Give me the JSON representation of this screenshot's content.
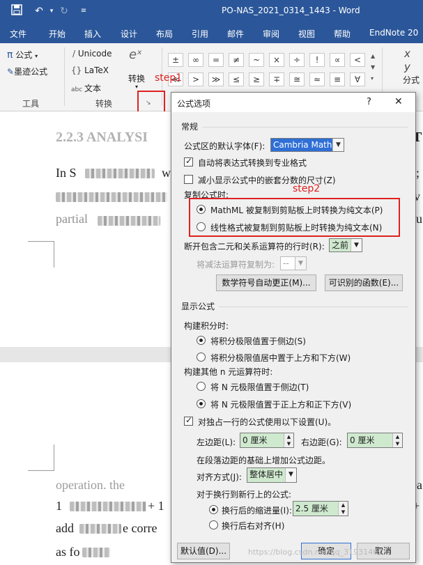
{
  "titlebar": {
    "title": "PO-NAS_2021_0314_1443  -  Word"
  },
  "menu": [
    "文件",
    "开始",
    "插入",
    "设计",
    "布局",
    "引用",
    "邮件",
    "审阅",
    "视图",
    "帮助",
    "EndNote 20"
  ],
  "ribbon": {
    "formula": "公式",
    "ink_formula": "墨迹公式",
    "group_tools": "工具",
    "unicode": "Unicode",
    "latex": "LaTeX",
    "text": "文本",
    "convert": "转换",
    "group_convert": "转换",
    "fraction": "分式",
    "symbols_row1": [
      "±",
      "∞",
      "=",
      "≠",
      "~",
      "×",
      "÷",
      "!",
      "∝",
      "<"
    ],
    "symbols_row2": [
      "≪",
      ">",
      "≫",
      "≤",
      "≥",
      "∓",
      "≅",
      "≈",
      "≡",
      "∀"
    ]
  },
  "annotations": {
    "step1": "step1",
    "step2": "step2"
  },
  "dialog": {
    "title": "公式选项",
    "help": "?",
    "close": "✕",
    "section_general": "常规",
    "default_font_label": "公式区的默认字体(F):",
    "default_font_value": "Cambria Math",
    "auto_convert_label": "自动将表达式转换到专业格式",
    "reduce_size_label": "减小显示公式中的嵌套分数的尺寸(Z)",
    "copy_label": "复制公式时:",
    "copy_opt1": "MathML 被复制到剪贴板上时转换为纯文本(P)",
    "copy_opt2": "线性格式被复制到剪贴板上时转换为纯文本(N)",
    "break_label": "断开包含二元和关系运算符的行时(R):",
    "break_value": "之前",
    "minus_label": "将减法运算符复制为:",
    "minus_value": "--",
    "autocorrect_btn": "数学符号自动更正(M)...",
    "functions_btn": "可识别的函数(E)...",
    "section_display": "显示公式",
    "integral_label": "构建积分时:",
    "integral_opt1": "将积分极限值置于侧边(S)",
    "integral_opt2": "将积分极限值居中置于上方和下方(W)",
    "nary_label": "构建其他 n 元运算符时:",
    "nary_opt1": "将 N 元极限值置于侧边(T)",
    "nary_opt2": "将 N 元极限值置于正上方和正下方(V)",
    "standalone_label": "对独占一行的公式使用以下设置(U)。",
    "left_margin_label": "左边距(L):",
    "left_margin_value": "0 厘米",
    "right_margin_label": "右边距(G):",
    "right_margin_value": "0 厘米",
    "margin_note": "在段落边距的基础上增加公式边距。",
    "align_label": "对齐方式(J):",
    "align_value": "整体居中",
    "wrap_label": "对于换行到新行上的公式:",
    "wrap_opt1": "换行后的缩进量(I):",
    "wrap_indent_value": "2.5 厘米",
    "wrap_opt2": "换行后右对齐(H)",
    "default_btn": "默认值(D)...",
    "ok_btn": "确定",
    "cancel_btn": "取消"
  },
  "document": {
    "heading_partial": "2.2.3 ANALYSI",
    "heading_tail": "T",
    "line1_start": "In S",
    "line1_mid": "w",
    "line1_end": "o;",
    "line3_start": "partial",
    "line3_end": "ou",
    "line_a_start": "operation. the",
    "line_b_start": "1",
    "line_b_mid": "+ 1",
    "line_c_start": "add",
    "line_c_mid": "e corre",
    "line_d_start": "as fo",
    "right_frag1": "ea",
    "right_frag2": "+",
    "right_frag3": "v"
  },
  "watermark": "https://blog.csdn.net/qq_31931461"
}
